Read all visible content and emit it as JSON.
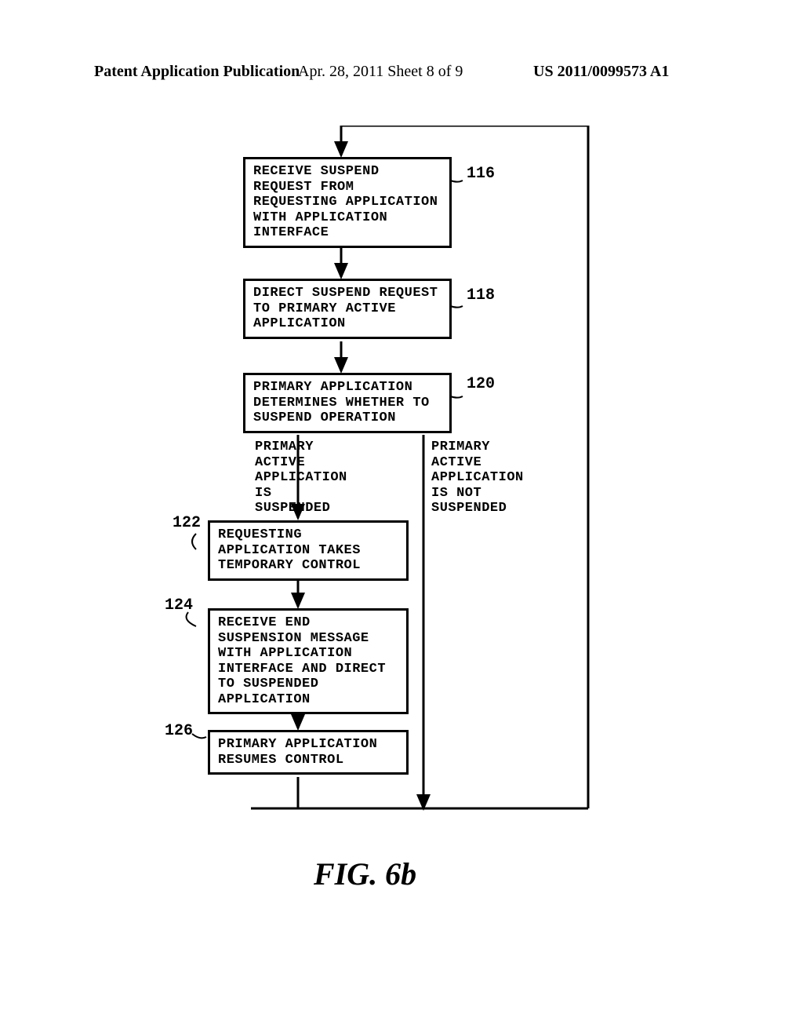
{
  "header": {
    "left": "Patent Application Publication",
    "center": "Apr. 28, 2011  Sheet 8 of 9",
    "right": "US 2011/0099573 A1"
  },
  "boxes": {
    "b116": "RECEIVE SUSPEND REQUEST FROM REQUESTING APPLICATION WITH APPLICATION INTERFACE",
    "b118": "DIRECT SUSPEND REQUEST TO PRIMARY ACTIVE APPLICATION",
    "b120": "PRIMARY APPLICATION DETERMINES WHETHER TO SUSPEND OPERATION",
    "b122": "REQUESTING APPLICATION TAKES TEMPORARY CONTROL",
    "b124": "RECEIVE END SUSPENSION MESSAGE WITH APPLICATION INTERFACE AND DIRECT TO SUSPENDED APPLICATION",
    "b126": "PRIMARY APPLICATION RESUMES CONTROL"
  },
  "branch": {
    "left": "PRIMARY ACTIVE APPLICATION IS SUSPENDED",
    "right": "PRIMARY ACTIVE APPLICATION IS NOT SUSPENDED"
  },
  "refs": {
    "r116": "116",
    "r118": "118",
    "r120": "120",
    "r122": "122",
    "r124": "124",
    "r126": "126"
  },
  "figure": "FIG. 6b"
}
